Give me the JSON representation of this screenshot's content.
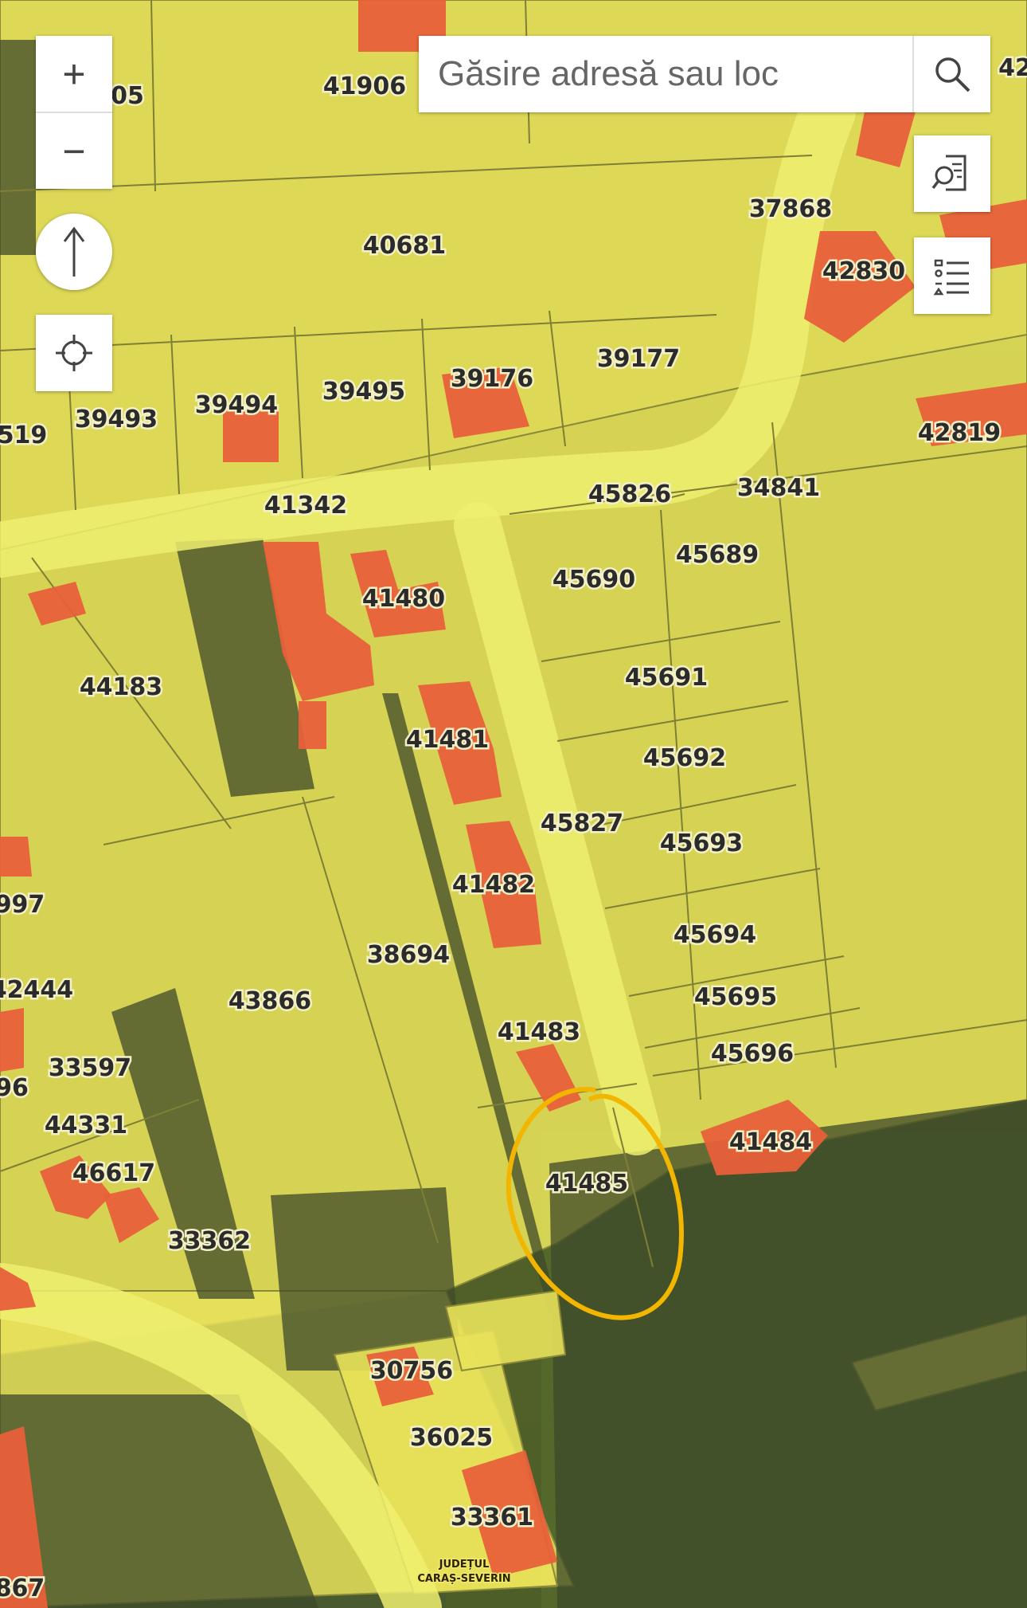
{
  "search": {
    "placeholder": "Găsire adresă sau loc"
  },
  "controls": {
    "zoom_in": "+",
    "zoom_out": "−",
    "north_arrow": "north-arrow-icon",
    "locate": "crosshair-icon",
    "search_icon": "search-icon",
    "identify_icon": "document-search-icon",
    "legend_icon": "legend-list-icon"
  },
  "map": {
    "county_label_line1": "JUDEȚUL",
    "county_label_line2": "CARAȘ-SEVERIN",
    "highlight_color": "#f2b600",
    "parcel_fill": "#e8e25a",
    "building_color": "#e8603a"
  },
  "parcels": [
    {
      "id": "41906"
    },
    {
      "id": "05"
    },
    {
      "id": "42"
    },
    {
      "id": "37868"
    },
    {
      "id": "42830"
    },
    {
      "id": "40681"
    },
    {
      "id": "39177"
    },
    {
      "id": "39176"
    },
    {
      "id": "39495"
    },
    {
      "id": "39494"
    },
    {
      "id": "39493"
    },
    {
      "id": "519"
    },
    {
      "id": "42819"
    },
    {
      "id": "41342"
    },
    {
      "id": "45826"
    },
    {
      "id": "34841"
    },
    {
      "id": "45690"
    },
    {
      "id": "45689"
    },
    {
      "id": "41480"
    },
    {
      "id": "44183"
    },
    {
      "id": "45691"
    },
    {
      "id": "41481"
    },
    {
      "id": "45692"
    },
    {
      "id": "45827"
    },
    {
      "id": "45693"
    },
    {
      "id": "41482"
    },
    {
      "id": "997"
    },
    {
      "id": "45694"
    },
    {
      "id": "38694"
    },
    {
      "id": "43866"
    },
    {
      "id": "42444"
    },
    {
      "id": "45695"
    },
    {
      "id": "41483"
    },
    {
      "id": "45696"
    },
    {
      "id": "33597"
    },
    {
      "id": "96"
    },
    {
      "id": "44331"
    },
    {
      "id": "41484"
    },
    {
      "id": "41485"
    },
    {
      "id": "46617"
    },
    {
      "id": "33362"
    },
    {
      "id": "30756"
    },
    {
      "id": "36025"
    },
    {
      "id": "33361"
    },
    {
      "id": "867"
    }
  ]
}
